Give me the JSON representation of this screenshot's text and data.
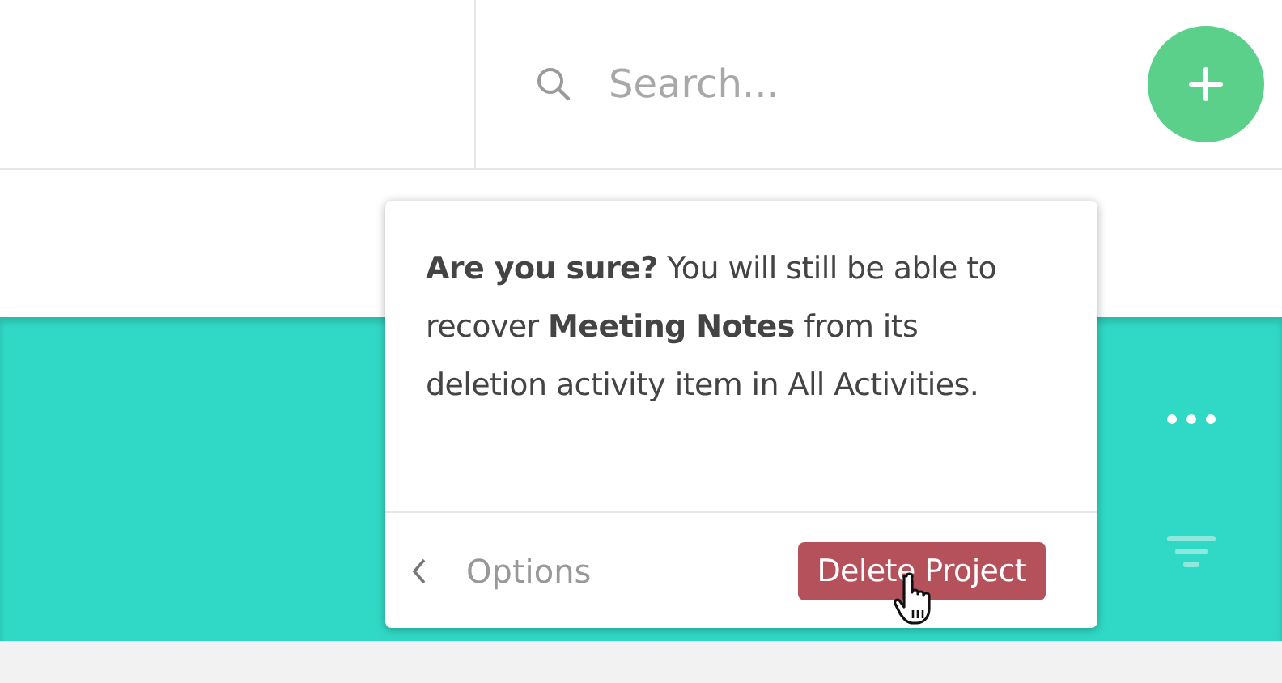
{
  "search": {
    "placeholder": "Search..."
  },
  "popover": {
    "message": "**Are you sure?** You will still be able to recover **Meeting Notes** from its deletion activity item in All Activities.",
    "back_label": "Options",
    "confirm_label": "Delete Project"
  }
}
